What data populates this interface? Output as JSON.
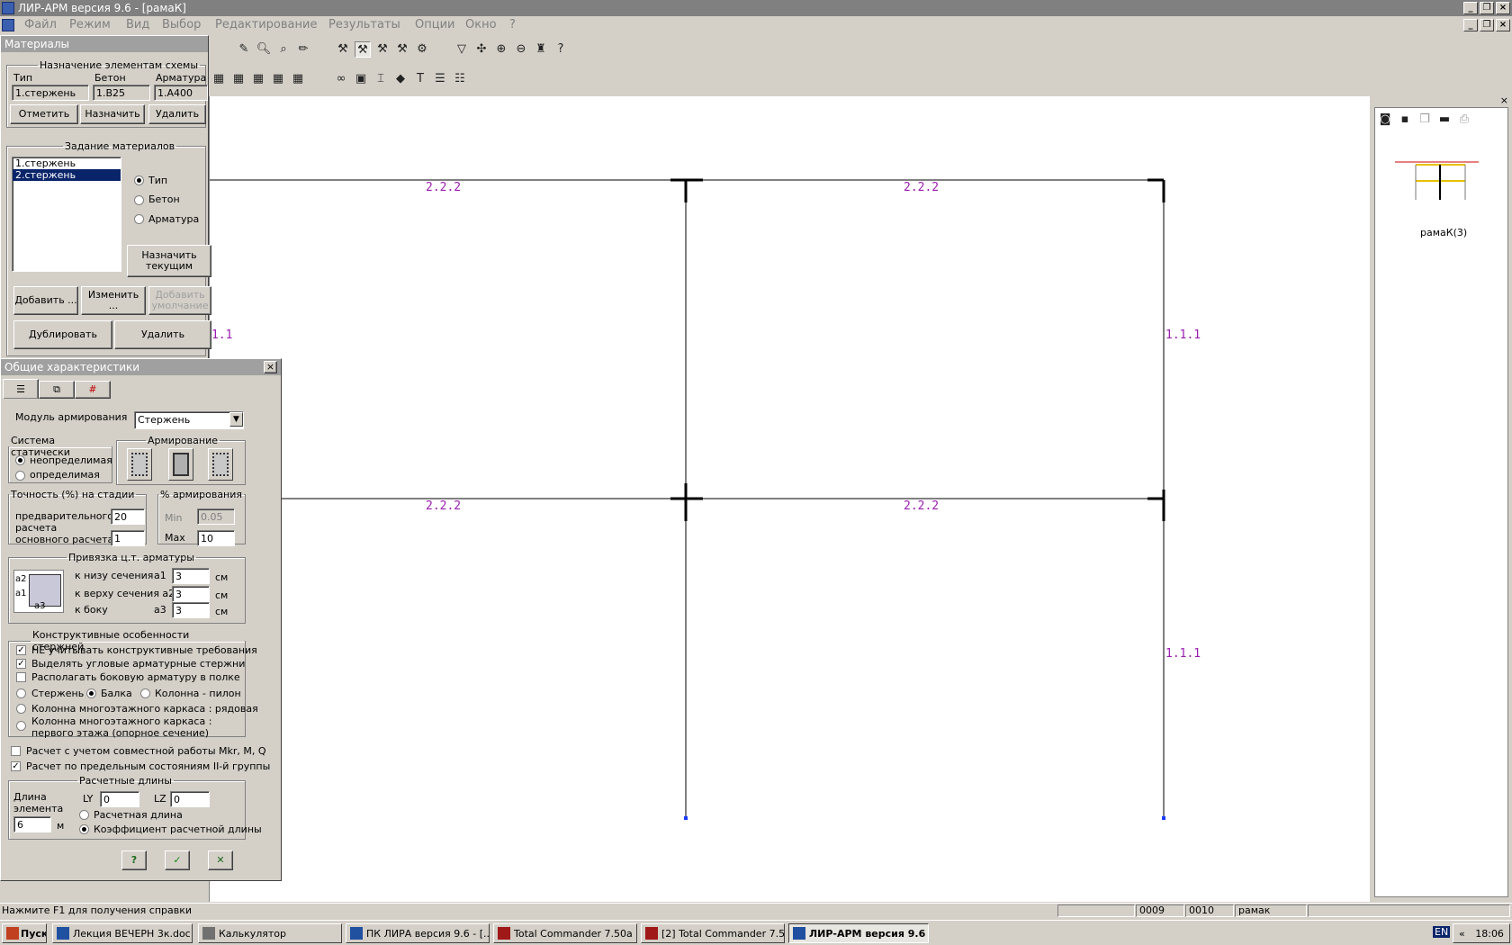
{
  "window": {
    "title": "ЛИР-АРМ версия 9.6  - [рамаК]"
  },
  "menu": [
    "Файл",
    "Режим",
    "Вид",
    "Выбор",
    "Редактирование",
    "Результаты",
    "Опции",
    "Окно",
    "?"
  ],
  "materials": {
    "title": "Материалы",
    "assign_group": "Назначение элементам схемы",
    "col_type": "Тип",
    "col_concrete": "Бетон",
    "col_rebar": "Арматура",
    "val_type": "1.стержень",
    "val_concrete": "1.B25",
    "val_rebar": "1.A400",
    "btn_mark": "Отметить",
    "btn_assign": "Назначить",
    "btn_delete": "Удалить",
    "spec_group": "Задание материалов",
    "list_items": [
      "1.стержень",
      "2.стержень"
    ],
    "radio_type": "Тип",
    "radio_concrete": "Бетон",
    "radio_rebar": "Арматура",
    "btn_assign_current": "Назначить текущим",
    "btn_add": "Добавить ...",
    "btn_change": "Изменить ...",
    "btn_add_default": "Добавить умолчание",
    "btn_duplicate": "Дублировать",
    "btn_delete2": "Удалить"
  },
  "general": {
    "title": "Общие характеристики",
    "module_label": "Модуль армирования",
    "module_value": "Стержень",
    "static_group": "Система статически",
    "static_indeterminate": "неопределимая",
    "static_determinate": "определимая",
    "reinf_group": "Армирование",
    "accuracy_group": "Точность (%) на стадии",
    "prelim_label": "предварительного расчета",
    "prelim_value": "20",
    "main_label": "основного расчета",
    "main_value": "1",
    "percent_group": "% армирования",
    "min_label": "Min",
    "min_value": "0.05",
    "max_label": "Max",
    "max_value": "10",
    "binding_group": "Привязка  ц.т. арматуры",
    "bottom_label": "к низу сечения",
    "a1": "a1",
    "a1_value": "3",
    "top_label": "к верху сечения a2",
    "a2_value": "3",
    "side_label": "к боку",
    "a3": "a3",
    "a3_value": "3",
    "unit_cm": "см",
    "diag_a2": "a2",
    "diag_a1": "a1",
    "diag_a3": "a3",
    "constr_group": "Конструктивные особенности стержней",
    "chk_no_constr": "НЕ учитывать конструктивные требования",
    "chk_corner": "Выделять угловые арматурные стержни",
    "chk_side": "Располагать боковую арматуру в полке",
    "r_rod": "Стержень",
    "r_beam": "Балка",
    "r_pylon": "Колонна - пилон",
    "r_col_row": "Колонна многоэтажного каркаса : рядовая",
    "r_col_first": "Колонна многоэтажного каркаса : первого этажа (опорное сечение)",
    "chk_joint": "Расчет с учетом совместной работы Mkr, M, Q",
    "chk_limit": "Расчет по предельным состояниям II-й группы",
    "lengths_group": "Расчетные длины",
    "elem_len_label": "Длина элемента",
    "elem_len_value": "6",
    "unit_m": "м",
    "ly_label": "LY",
    "ly_value": "0",
    "lz_label": "LZ",
    "lz_value": "0",
    "r_calc_len": "Расчетная длина",
    "r_coef_len": "Коэффициент расчетной длины"
  },
  "drawing": {
    "labels": [
      "2.2.2",
      "2.2.2",
      "2.2.2",
      "2.2.2",
      "1.1",
      "1.1.1",
      "1.1.1"
    ],
    "label_color": "#9b1cb0"
  },
  "preview": {
    "caption": "рамаК(3)"
  },
  "status": {
    "hint": "Нажмите F1 для получения справки",
    "s1": "0009",
    "s2": "0010",
    "s3": "рамак"
  },
  "taskbar": {
    "start": "Пуск",
    "tasks": [
      "Лекция ВЕЧЕРН 3к.doc ...",
      "Калькулятор",
      "ПК ЛИРА  версия 9.6 - [...",
      "Total Commander 7.50a ...",
      "[2] Total Commander 7.5...",
      "ЛИР-АРМ версия 9.6  ..."
    ],
    "lang": "EN",
    "clock": "18:06",
    "tray_arrow": "«"
  }
}
